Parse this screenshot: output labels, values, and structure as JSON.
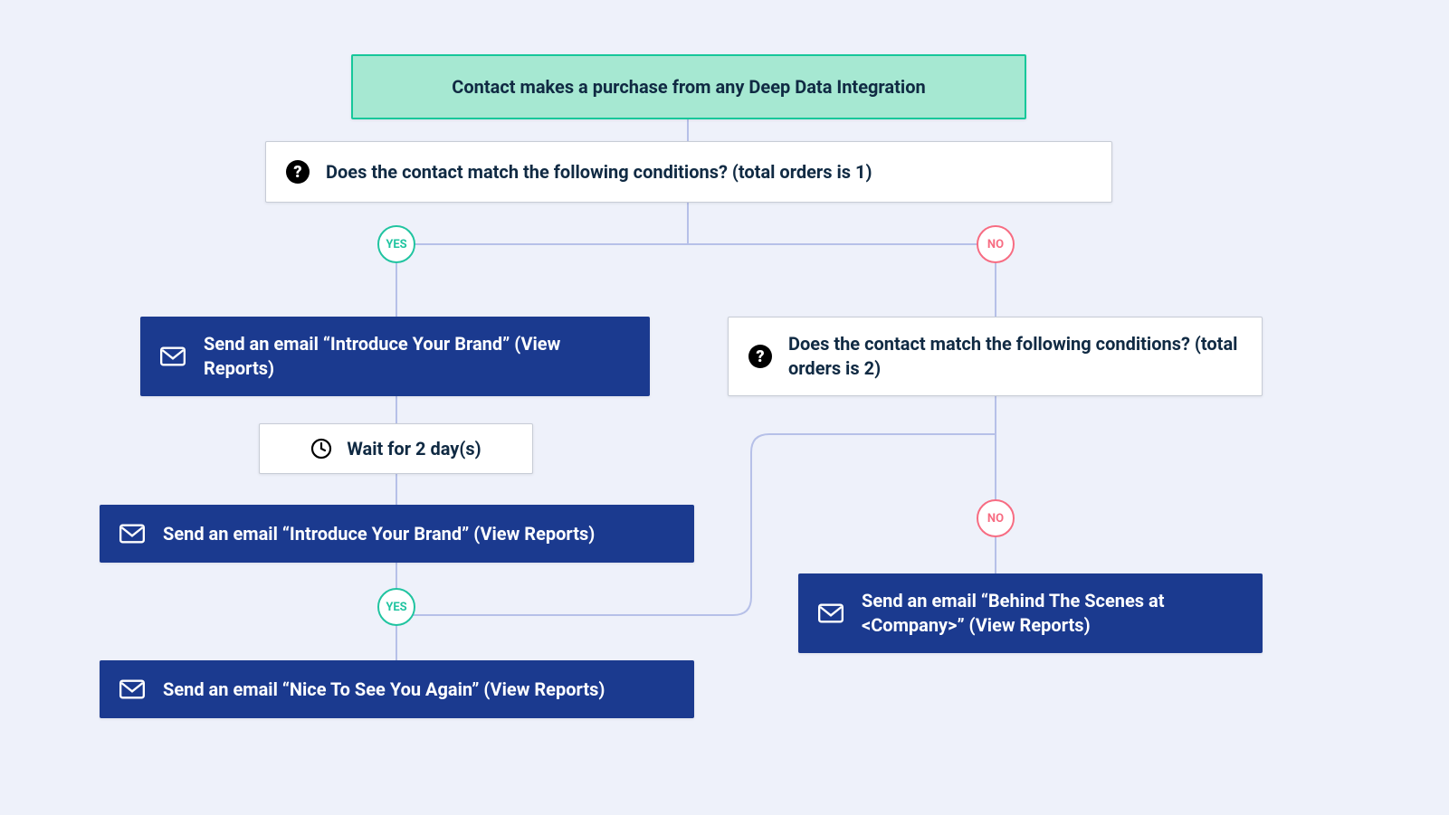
{
  "trigger": {
    "text": "Contact makes a purchase from any Deep Data Integration"
  },
  "cond1": {
    "text": "Does the contact match the following conditions? (total orders is 1)"
  },
  "cond2": {
    "text": "Does the contact match the following conditions? (total orders is 2)"
  },
  "action1": {
    "text": "Send an email “Introduce Your Brand” (View Reports)"
  },
  "wait": {
    "text": "Wait for 2 day(s)"
  },
  "action2": {
    "text": "Send an email “Introduce Your Brand” (View Reports)"
  },
  "action3": {
    "text": "Send an email “Nice To See You Again” (View Reports)"
  },
  "action4": {
    "text": "Send an email “Behind The Scenes at <Company>” (View Reports)"
  },
  "labels": {
    "yes": "YES",
    "no": "NO"
  }
}
